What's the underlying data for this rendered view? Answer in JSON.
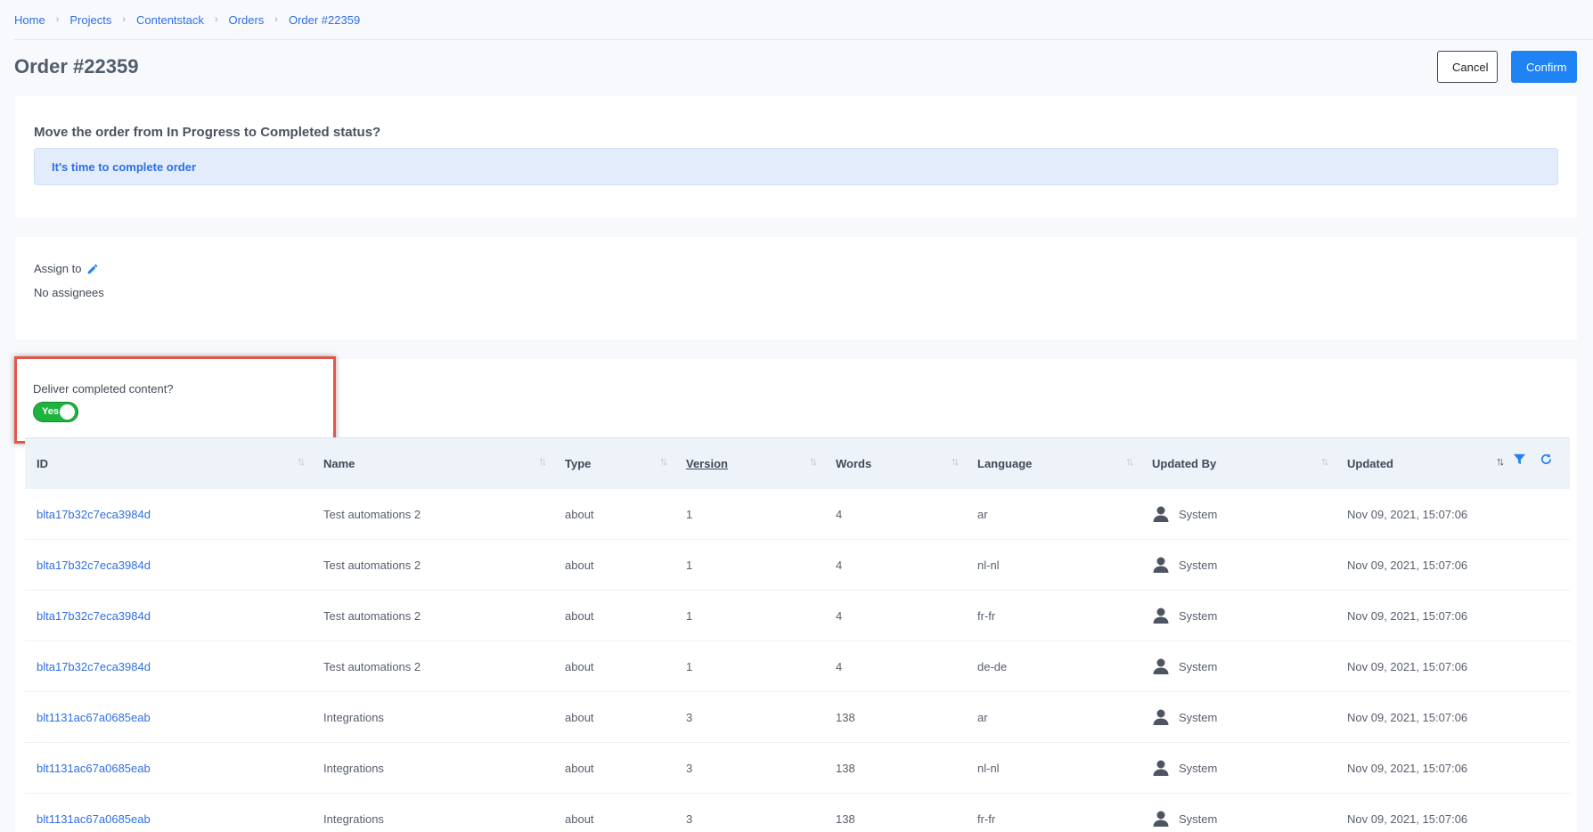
{
  "breadcrumb": [
    "Home",
    "Projects",
    "Contentstack",
    "Orders",
    "Order #22359"
  ],
  "page": {
    "title": "Order #22359",
    "cancel_label": "Cancel",
    "confirm_label": "Confirm"
  },
  "status": {
    "question": "Move the order from In Progress to Completed status?",
    "banner": "It's time to complete order"
  },
  "assign": {
    "label": "Assign to",
    "value": "No assignees"
  },
  "deliver": {
    "label": "Deliver completed content?",
    "toggle_label": "Yes",
    "toggle_on": true
  },
  "colors": {
    "accent": "#1f82f5",
    "link": "#2f6fe4",
    "toggle_on": "#1db33f",
    "highlight_border": "#e2574c"
  },
  "table": {
    "columns": [
      "ID",
      "Name",
      "Type",
      "Version",
      "Words",
      "Language",
      "Updated By",
      "Updated"
    ],
    "rows": [
      {
        "id": "blta17b32c7eca3984d",
        "name": "Test automations 2",
        "type": "about",
        "version": "1",
        "words": "4",
        "language": "ar",
        "updated_by": "System",
        "updated": "Nov 09, 2021, 15:07:06"
      },
      {
        "id": "blta17b32c7eca3984d",
        "name": "Test automations 2",
        "type": "about",
        "version": "1",
        "words": "4",
        "language": "nl-nl",
        "updated_by": "System",
        "updated": "Nov 09, 2021, 15:07:06"
      },
      {
        "id": "blta17b32c7eca3984d",
        "name": "Test automations 2",
        "type": "about",
        "version": "1",
        "words": "4",
        "language": "fr-fr",
        "updated_by": "System",
        "updated": "Nov 09, 2021, 15:07:06"
      },
      {
        "id": "blta17b32c7eca3984d",
        "name": "Test automations 2",
        "type": "about",
        "version": "1",
        "words": "4",
        "language": "de-de",
        "updated_by": "System",
        "updated": "Nov 09, 2021, 15:07:06"
      },
      {
        "id": "blt1131ac67a0685eab",
        "name": "Integrations",
        "type": "about",
        "version": "3",
        "words": "138",
        "language": "ar",
        "updated_by": "System",
        "updated": "Nov 09, 2021, 15:07:06"
      },
      {
        "id": "blt1131ac67a0685eab",
        "name": "Integrations",
        "type": "about",
        "version": "3",
        "words": "138",
        "language": "nl-nl",
        "updated_by": "System",
        "updated": "Nov 09, 2021, 15:07:06"
      },
      {
        "id": "blt1131ac67a0685eab",
        "name": "Integrations",
        "type": "about",
        "version": "3",
        "words": "138",
        "language": "fr-fr",
        "updated_by": "System",
        "updated": "Nov 09, 2021, 15:07:06"
      }
    ]
  }
}
